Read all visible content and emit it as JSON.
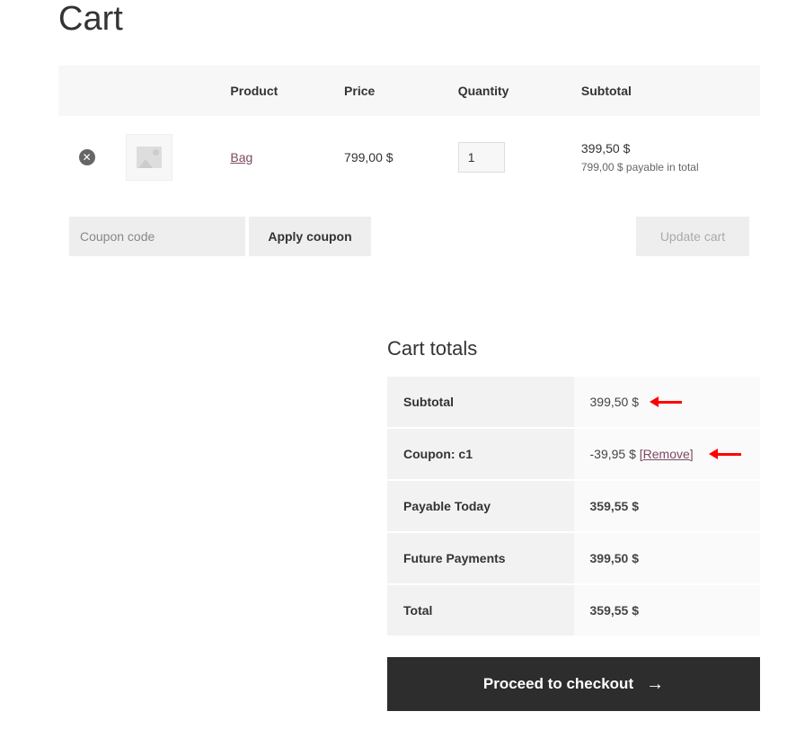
{
  "page": {
    "title": "Cart"
  },
  "table": {
    "headers": {
      "product": "Product",
      "price": "Price",
      "quantity": "Quantity",
      "subtotal": "Subtotal"
    }
  },
  "items": [
    {
      "name": "Bag",
      "price": "799,00 $",
      "quantity": "1",
      "subtotal": "399,50 $",
      "subtotal_note": "799,00 $ payable in total"
    }
  ],
  "coupon": {
    "placeholder": "Coupon code",
    "apply_label": "Apply coupon",
    "update_label": "Update cart"
  },
  "totals": {
    "heading": "Cart totals",
    "subtotal_label": "Subtotal",
    "subtotal_value": "399,50 $",
    "coupon_label": "Coupon: c1",
    "coupon_value": "-39,95 $ ",
    "coupon_remove": "[Remove]",
    "payable_label": "Payable Today",
    "payable_value": "359,55 $",
    "future_label": "Future Payments",
    "future_value": "399,50 $",
    "total_label": "Total",
    "total_value": "359,55 $"
  },
  "checkout": {
    "label": "Proceed to checkout"
  }
}
